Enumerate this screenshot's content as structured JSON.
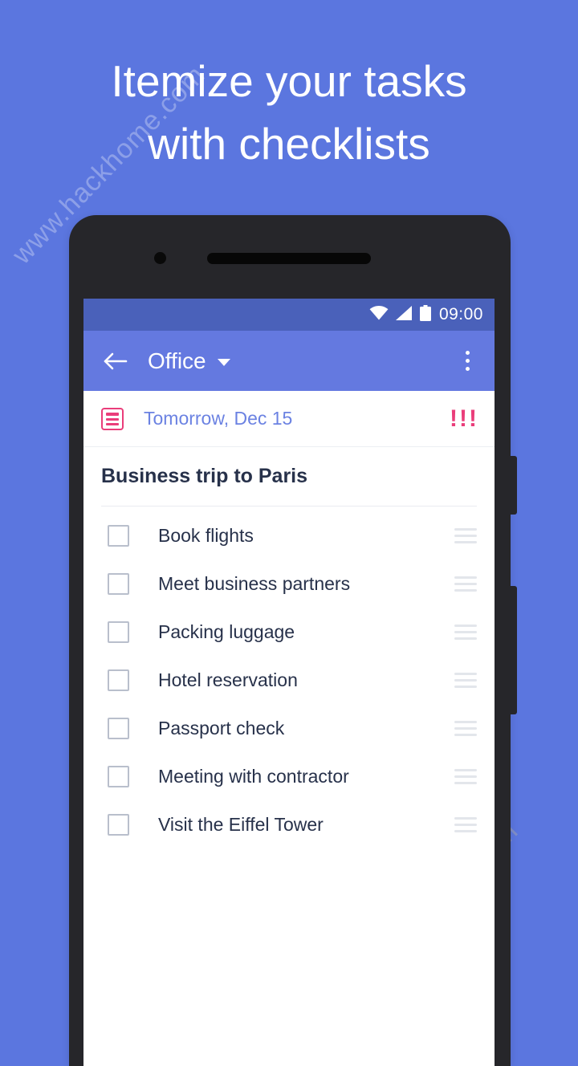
{
  "headline": {
    "line1": "Itemize your tasks",
    "line2": "with checklists"
  },
  "watermark": {
    "text": "www.hackhome.com"
  },
  "colors": {
    "background": "#5b76df",
    "appbar": "#6479e0",
    "statusbar": "#4a61ba",
    "accent_pink": "#ea3d7a",
    "text_dark": "#27314a",
    "date_blue": "#6b82e2",
    "checkbox_border": "#b9bfcc",
    "phone_frame": "#26262a"
  },
  "phone": {
    "statusbar": {
      "time": "09:00",
      "icons": [
        "wifi-icon",
        "signal-icon",
        "battery-icon"
      ]
    },
    "appbar": {
      "back_label": "back-arrow",
      "title": "Office",
      "dropdown_caret": "chevron-down-icon",
      "overflow_label": "overflow-menu"
    },
    "date_row": {
      "icon": "checklist-icon",
      "text": "Tomorrow, Dec 15",
      "priority": "!!!"
    },
    "task": {
      "title": "Business trip to Paris",
      "items": [
        {
          "label": "Book flights",
          "checked": false
        },
        {
          "label": "Meet business partners",
          "checked": false
        },
        {
          "label": "Packing luggage",
          "checked": false
        },
        {
          "label": "Hotel reservation",
          "checked": false
        },
        {
          "label": "Passport check",
          "checked": false
        },
        {
          "label": "Meeting with contractor",
          "checked": false
        },
        {
          "label": "Visit the Eiffel Tower",
          "checked": false
        }
      ]
    }
  }
}
